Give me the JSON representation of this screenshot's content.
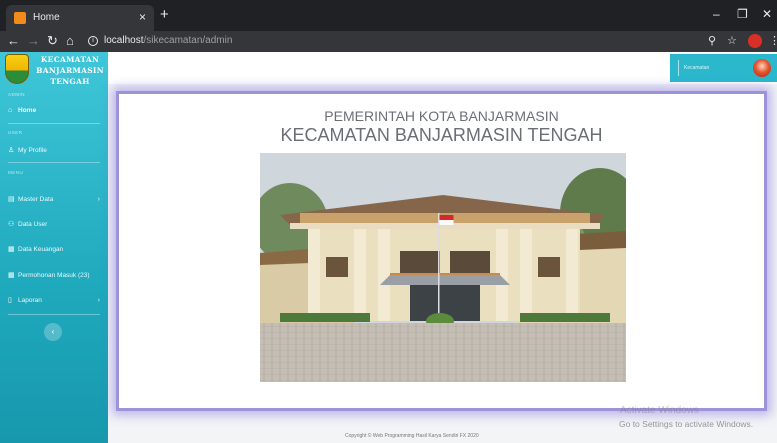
{
  "browser": {
    "tab_title": "Home",
    "tab_close": "×",
    "new_tab": "+",
    "url_host": "localhost",
    "url_path": "/sikecamatan/admin",
    "controls": {
      "minimize": "–",
      "maximize": "❐",
      "close": "✕"
    }
  },
  "brand": {
    "line1": "KECAMATAN",
    "line2": "BANJARMASIN",
    "line3": "TENGAH"
  },
  "sidebar": {
    "sections": {
      "admin": "ADMIN",
      "user": "USER",
      "menu": "MENU"
    },
    "items": [
      {
        "label": "Home",
        "icon": "home-icon"
      },
      {
        "label": "My Profile",
        "icon": "user-icon"
      },
      {
        "label": "Master Data",
        "icon": "folder-icon"
      },
      {
        "label": "Data User",
        "icon": "users-icon"
      },
      {
        "label": "Data Keuangan",
        "icon": "table-icon"
      },
      {
        "label": "Permohonan Masuk (23)",
        "icon": "table-icon"
      },
      {
        "label": "Laporan",
        "icon": "file-icon"
      }
    ],
    "chevron": "›",
    "collapse_icon": "‹"
  },
  "topbar": {
    "user_name": "Kecamatan"
  },
  "main": {
    "gov_title": "PEMERINTAH KOTA BANJARMASIN",
    "kecamatan_title": "KECAMATAN BANJARMASIN TENGAH"
  },
  "footer": {
    "copyright": "Copyright © Web Programming Hasil Karya Sendiri FX 2020"
  },
  "watermark": {
    "line1": "Activate Windows",
    "line2": "Go to Settings to activate Windows."
  },
  "colors": {
    "sidebar_top": "#3fc6d9",
    "sidebar_bottom": "#1798ad",
    "card_border": "#9d93d8",
    "user_box": "#2bb8cc"
  }
}
